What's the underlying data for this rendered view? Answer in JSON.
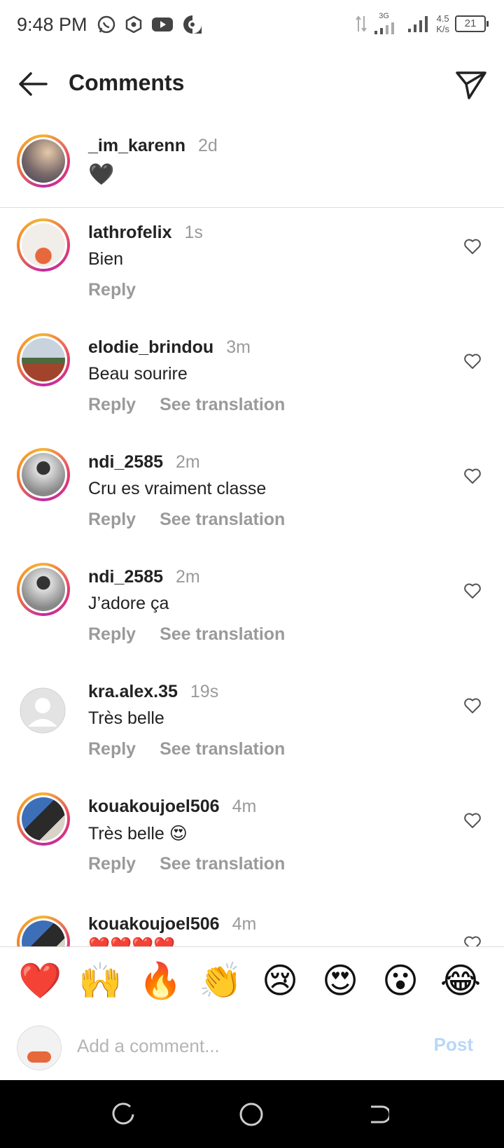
{
  "status_bar": {
    "time": "9:48 PM",
    "network_type": "3G",
    "speed_value": "4.5",
    "speed_unit": "K/s",
    "battery": "21"
  },
  "header": {
    "title": "Comments"
  },
  "caption": {
    "username": "_im_karenn",
    "time": "2d",
    "text": "🖤"
  },
  "comments": [
    {
      "username": "lathrofelix",
      "time": "1s",
      "text": "Bien",
      "reply": "Reply",
      "translate": ""
    },
    {
      "username": "elodie_brindou",
      "time": "3m",
      "text": "Beau sourire",
      "reply": "Reply",
      "translate": "See translation"
    },
    {
      "username": "ndi_2585",
      "time": "2m",
      "text": "Cru es vraiment classe",
      "reply": "Reply",
      "translate": "See translation"
    },
    {
      "username": "ndi_2585",
      "time": "2m",
      "text": "J’adore ça",
      "reply": "Reply",
      "translate": "See translation"
    },
    {
      "username": "kra.alex.35",
      "time": "19s",
      "text": "Très belle",
      "reply": "Reply",
      "translate": "See translation"
    },
    {
      "username": "kouakoujoel506",
      "time": "4m",
      "text": "Très belle 😍",
      "reply": "Reply",
      "translate": "See translation"
    },
    {
      "username": "kouakoujoel506",
      "time": "4m",
      "text": "❤️❤️❤️❤️",
      "reply": "",
      "translate": ""
    }
  ],
  "emoji_bar": [
    "❤️",
    "🙌",
    "🔥",
    "👏",
    "😢",
    "😍",
    "😮",
    "😂"
  ],
  "comment_input": {
    "placeholder": "Add a comment...",
    "post_label": "Post"
  }
}
